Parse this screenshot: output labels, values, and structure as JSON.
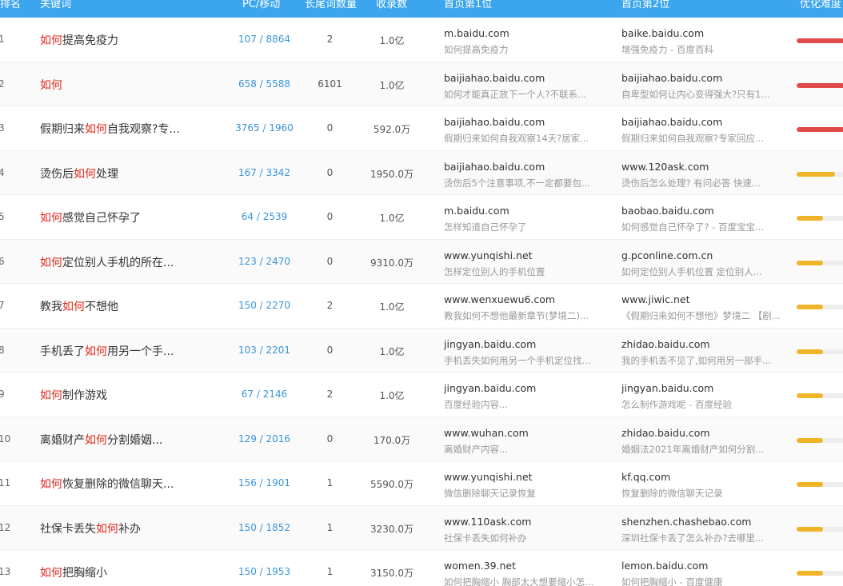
{
  "header": {
    "idx": "排名",
    "keyword": "关键词",
    "pc_mobile": "PC/移动",
    "long_tail": "长尾词数量",
    "indexed": "收录数",
    "top1": "首页第1位",
    "top2": "首页第2位",
    "difficulty": "优化难度"
  },
  "colors": {
    "header_bg": "#3ba6ee",
    "highlight": "#e3261b",
    "link": "#3b95d8",
    "bar_high": "#e04a48",
    "bar_mid": "#f0b429",
    "bar_track": "#eeeeee"
  },
  "rows": [
    {
      "idx": "1",
      "kw": [
        {
          "t": "如何",
          "h": true
        },
        {
          "t": "提高免疫力",
          "h": false
        }
      ],
      "pc": "107 / 8864",
      "deep": "2",
      "rec": "1.0亿",
      "site1": "m.baidu.com",
      "desc1": "如何提高免疫力",
      "site2": "baike.baidu.com",
      "desc2": "增强免疫力 - 百度百科",
      "level": "high",
      "difficulty": 1.0
    },
    {
      "idx": "2",
      "kw": [
        {
          "t": "如何",
          "h": true
        }
      ],
      "pc": "658 / 5588",
      "deep": "6101",
      "rec": "1.0亿",
      "site1": "baijiahao.baidu.com",
      "desc1": "如何才能真正放下一个人?不联系...",
      "site2": "baijiahao.baidu.com",
      "desc2": "自卑型如何让内心变得强大?只有1...",
      "level": "high",
      "difficulty": 1.0
    },
    {
      "idx": "3",
      "kw": [
        {
          "t": "假期归来",
          "h": false
        },
        {
          "t": "如何",
          "h": true
        },
        {
          "t": "自我观察?专...",
          "h": false
        }
      ],
      "pc": "3765 / 1960",
      "deep": "0",
      "rec": "592.0万",
      "site1": "baijiahao.baidu.com",
      "desc1": "假期归来如何自我观察14天?居家...",
      "site2": "baijiahao.baidu.com",
      "desc2": "假期归来如何自我观察?专家回应...",
      "level": "high",
      "difficulty": 1.0
    },
    {
      "idx": "4",
      "kw": [
        {
          "t": "烫伤后",
          "h": false
        },
        {
          "t": "如何",
          "h": true
        },
        {
          "t": "处理",
          "h": false
        }
      ],
      "pc": "167 / 3342",
      "deep": "0",
      "rec": "1950.0万",
      "site1": "baijiahao.baidu.com",
      "desc1": "烫伤后5个注意事项,不一定都要包...",
      "site2": "www.120ask.com",
      "desc2": "烫伤后怎么处理? 有问必答 快速...",
      "level": "mid",
      "difficulty": 0.8
    },
    {
      "idx": "5",
      "kw": [
        {
          "t": "如何",
          "h": true
        },
        {
          "t": "感觉自己怀孕了",
          "h": false
        }
      ],
      "pc": "64 / 2539",
      "deep": "0",
      "rec": "1.0亿",
      "site1": "m.baidu.com",
      "desc1": "怎样知道自己怀孕了",
      "site2": "baobao.baidu.com",
      "desc2": "如何感觉自己怀孕了? - 百度宝宝...",
      "level": "mid",
      "difficulty": 0.55
    },
    {
      "idx": "6",
      "kw": [
        {
          "t": "如何",
          "h": true
        },
        {
          "t": "定位别人手机的所在...",
          "h": false
        }
      ],
      "pc": "123 / 2470",
      "deep": "0",
      "rec": "9310.0万",
      "site1": "www.yunqishi.net",
      "desc1": "怎样定位别人的手机位置",
      "site2": "g.pconline.com.cn",
      "desc2": "如何定位别人手机位置 定位别人...",
      "level": "mid",
      "difficulty": 0.55
    },
    {
      "idx": "7",
      "kw": [
        {
          "t": "教我",
          "h": false
        },
        {
          "t": "如何",
          "h": true
        },
        {
          "t": "不想他",
          "h": false
        }
      ],
      "pc": "150 / 2270",
      "deep": "2",
      "rec": "1.0亿",
      "site1": "www.wenxuewu6.com",
      "desc1": "教我如何不想他最新章节(梦境二)...",
      "site2": "www.jiwic.net",
      "desc2": "《假期归来如何不想他》梦境二 【剧...",
      "level": "mid",
      "difficulty": 0.55
    },
    {
      "idx": "8",
      "kw": [
        {
          "t": "手机丢了",
          "h": false
        },
        {
          "t": "如何",
          "h": true
        },
        {
          "t": "用另一个手...",
          "h": false
        }
      ],
      "pc": "103 / 2201",
      "deep": "0",
      "rec": "1.0亿",
      "site1": "jingyan.baidu.com",
      "desc1": "手机丢失如何用另一个手机定位找...",
      "site2": "zhidao.baidu.com",
      "desc2": "我的手机丢不见了,如何用另一部手...",
      "level": "mid",
      "difficulty": 0.55
    },
    {
      "idx": "9",
      "kw": [
        {
          "t": "如何",
          "h": true
        },
        {
          "t": "制作游戏",
          "h": false
        }
      ],
      "pc": "67 / 2146",
      "deep": "2",
      "rec": "1.0亿",
      "site1": "jingyan.baidu.com",
      "desc1": "百度经验内容...",
      "site2": "jingyan.baidu.com",
      "desc2": "怎么制作游戏呢 - 百度经验",
      "level": "mid",
      "difficulty": 0.55
    },
    {
      "idx": "10",
      "kw": [
        {
          "t": "离婚财产",
          "h": false
        },
        {
          "t": "如何",
          "h": true
        },
        {
          "t": "分割婚姻...",
          "h": false
        }
      ],
      "pc": "129 / 2016",
      "deep": "0",
      "rec": "170.0万",
      "site1": "www.wuhan.com",
      "desc1": "离婚财产内容...",
      "site2": "zhidao.baidu.com",
      "desc2": "婚姻法2021年离婚财产如何分割...",
      "level": "mid",
      "difficulty": 0.55
    },
    {
      "idx": "11",
      "kw": [
        {
          "t": "如何",
          "h": true
        },
        {
          "t": "恢复删除的微信聊天...",
          "h": false
        }
      ],
      "pc": "156 / 1901",
      "deep": "1",
      "rec": "5590.0万",
      "site1": "www.yunqishi.net",
      "desc1": "微信删除聊天记录恢复",
      "site2": "kf.qq.com",
      "desc2": "恢复删除的微信聊天记录",
      "level": "mid",
      "difficulty": 0.55
    },
    {
      "idx": "12",
      "kw": [
        {
          "t": "社保卡丢失",
          "h": false
        },
        {
          "t": "如何",
          "h": true
        },
        {
          "t": "补办",
          "h": false
        }
      ],
      "pc": "150 / 1852",
      "deep": "1",
      "rec": "3230.0万",
      "site1": "www.110ask.com",
      "desc1": "社保卡丢失如何补办",
      "site2": "shenzhen.chashebao.com",
      "desc2": "深圳社保卡丢了怎么补办?去哪里...",
      "level": "mid",
      "difficulty": 0.55
    },
    {
      "idx": "13",
      "kw": [
        {
          "t": "如何",
          "h": true
        },
        {
          "t": "把胸缩小",
          "h": false
        }
      ],
      "pc": "150 / 1953",
      "deep": "1",
      "rec": "3150.0万",
      "site1": "women.39.net",
      "desc1": "如何把胸缩小 胸部太大想要缩小怎...",
      "site2": "lemon.baidu.com",
      "desc2": "如何把胸缩小 - 百度健康",
      "level": "mid",
      "difficulty": 0.55
    }
  ]
}
